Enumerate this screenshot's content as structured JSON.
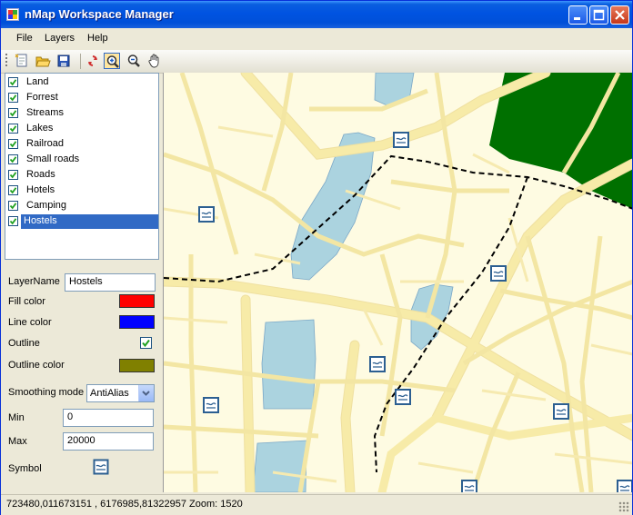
{
  "window": {
    "title": "nMap Workspace Manager",
    "accent": "#0053e1"
  },
  "menu": [
    "File",
    "Layers",
    "Help"
  ],
  "toolbar": {
    "tools": [
      "new-icon",
      "open-icon",
      "save-icon",
      "refresh-icon",
      "zoom-in-icon",
      "zoom-out-icon",
      "pan-hand-icon"
    ],
    "active_tool": "zoom-in-icon"
  },
  "layers": [
    {
      "label": "Land",
      "checked": true
    },
    {
      "label": "Forrest",
      "checked": true
    },
    {
      "label": "Streams",
      "checked": true
    },
    {
      "label": "Lakes",
      "checked": true
    },
    {
      "label": "Railroad",
      "checked": true
    },
    {
      "label": "Small roads",
      "checked": true
    },
    {
      "label": "Roads",
      "checked": true
    },
    {
      "label": "Hotels",
      "checked": true
    },
    {
      "label": "Camping",
      "checked": true
    },
    {
      "label": "Hostels",
      "checked": true,
      "selected": true
    }
  ],
  "properties": {
    "layer_name_label": "LayerName",
    "layer_name_value": "Hostels",
    "fill_color_label": "Fill color",
    "fill_color": "#ff0000",
    "line_color_label": "Line color",
    "line_color": "#0000ff",
    "outline_label": "Outline",
    "outline_checked": true,
    "outline_color_label": "Outline color",
    "outline_color": "#808000",
    "smoothing_label": "Smoothing mode",
    "smoothing_value": "AntiAlias",
    "min_label": "Min",
    "min_value": "0",
    "max_label": "Max",
    "max_value": "20000",
    "symbol_label": "Symbol",
    "symbol_icon": "hostel-symbol-icon"
  },
  "map": {
    "land_color": "#fefbe2",
    "road_color": "#f7eba8",
    "lake_color": "#abd3df",
    "forest_color": "#007000",
    "hostel_count": 9
  },
  "status": {
    "text": "723480,011673151 , 6176985,81322957 Zoom: 1520"
  }
}
